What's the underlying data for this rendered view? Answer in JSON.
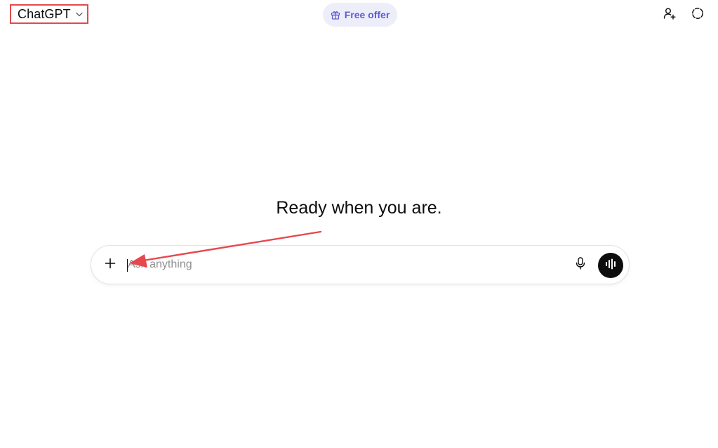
{
  "header": {
    "model_name": "ChatGPT",
    "free_offer_label": "Free offer"
  },
  "hero": {
    "title": "Ready when you are."
  },
  "composer": {
    "placeholder": "Ask anything",
    "value": ""
  },
  "icons": {
    "model_chevron": "chevron-down-icon",
    "free_offer": "gift-icon",
    "add_person": "add-person-icon",
    "temporary_chat": "temporary-chat-icon",
    "attach": "plus-icon",
    "dictate": "microphone-icon",
    "voice_mode": "voice-waveform-icon",
    "annotation": "annotation-arrow-icon"
  },
  "colors": {
    "annotation": "#e5484d",
    "free_offer_text": "#5b5bd6",
    "free_offer_bg": "#eeeefb",
    "voice_button_bg": "#0d0d0d"
  }
}
